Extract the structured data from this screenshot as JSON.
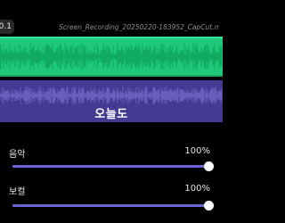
{
  "header": {
    "time": "0.1",
    "file_name": "Screen_Recording_20250220-183952_CapCut.mp4"
  },
  "tracks": {
    "video_color": "#1ec97a",
    "audio_color": "#443a92",
    "audio_title": "오늘도"
  },
  "controls": {
    "music": {
      "label": "음악",
      "value": "100%",
      "level": 1.0
    },
    "vocal": {
      "label": "보컬",
      "value": "100%",
      "level": 1.0
    }
  },
  "colors": {
    "accent": "#6d63d6",
    "background": "#000000"
  }
}
